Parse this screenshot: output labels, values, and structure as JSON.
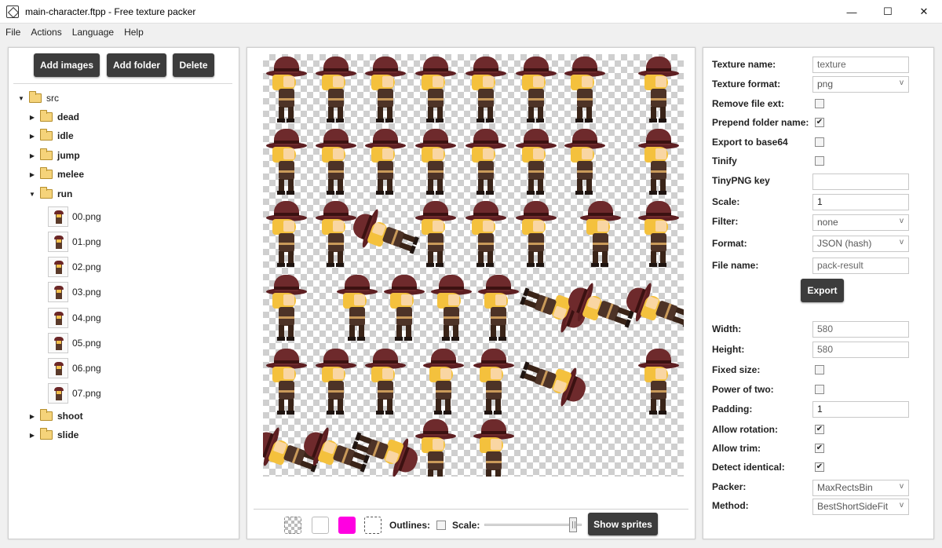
{
  "window": {
    "title": "main-character.ftpp - Free texture packer",
    "controls": {
      "minimize": "—",
      "maximize": "☐",
      "close": "✕"
    }
  },
  "menu": [
    "File",
    "Actions",
    "Language",
    "Help"
  ],
  "left": {
    "buttons": {
      "add_images": "Add images",
      "add_folder": "Add folder",
      "delete": "Delete"
    },
    "tree": {
      "root": "src",
      "folders": [
        "dead",
        "idle",
        "jump",
        "melee",
        "run",
        "shoot",
        "slide"
      ],
      "run_files": [
        "00.png",
        "01.png",
        "02.png",
        "03.png",
        "04.png",
        "05.png",
        "06.png",
        "07.png"
      ]
    }
  },
  "center": {
    "outlines_label": "Outlines:",
    "scale_label": "Scale:",
    "show_sprites": "Show sprites",
    "scale_value": 0.95,
    "outlines_checked": false,
    "swatch_colors": {
      "white": "#ffffff",
      "magenta": "#ff00e1"
    }
  },
  "right": {
    "texture_name_label": "Texture name:",
    "texture_name_value": "texture",
    "texture_format_label": "Texture format:",
    "texture_format_value": "png",
    "remove_ext_label": "Remove file ext:",
    "remove_ext_checked": false,
    "prepend_folder_label": "Prepend folder name:",
    "prepend_folder_checked": true,
    "export_base64_label": "Export to base64",
    "export_base64_checked": false,
    "tinify_label": "Tinify",
    "tinify_checked": false,
    "tinypng_key_label": "TinyPNG key",
    "tinypng_key_value": "",
    "scale_label": "Scale:",
    "scale_value": "1",
    "filter_label": "Filter:",
    "filter_value": "none",
    "format_label": "Format:",
    "format_value": "JSON (hash)",
    "file_name_label": "File name:",
    "file_name_value": "pack-result",
    "export_button": "Export",
    "width_label": "Width:",
    "width_value": "580",
    "height_label": "Height:",
    "height_value": "580",
    "fixed_size_label": "Fixed size:",
    "fixed_size_checked": false,
    "power_of_two_label": "Power of two:",
    "power_of_two_checked": false,
    "padding_label": "Padding:",
    "padding_value": "1",
    "allow_rotation_label": "Allow rotation:",
    "allow_rotation_checked": true,
    "allow_trim_label": "Allow trim:",
    "allow_trim_checked": true,
    "detect_identical_label": "Detect identical:",
    "detect_identical_checked": true,
    "packer_label": "Packer:",
    "packer_value": "MaxRectsBin",
    "method_label": "Method:",
    "method_value": "BestShortSideFit"
  }
}
